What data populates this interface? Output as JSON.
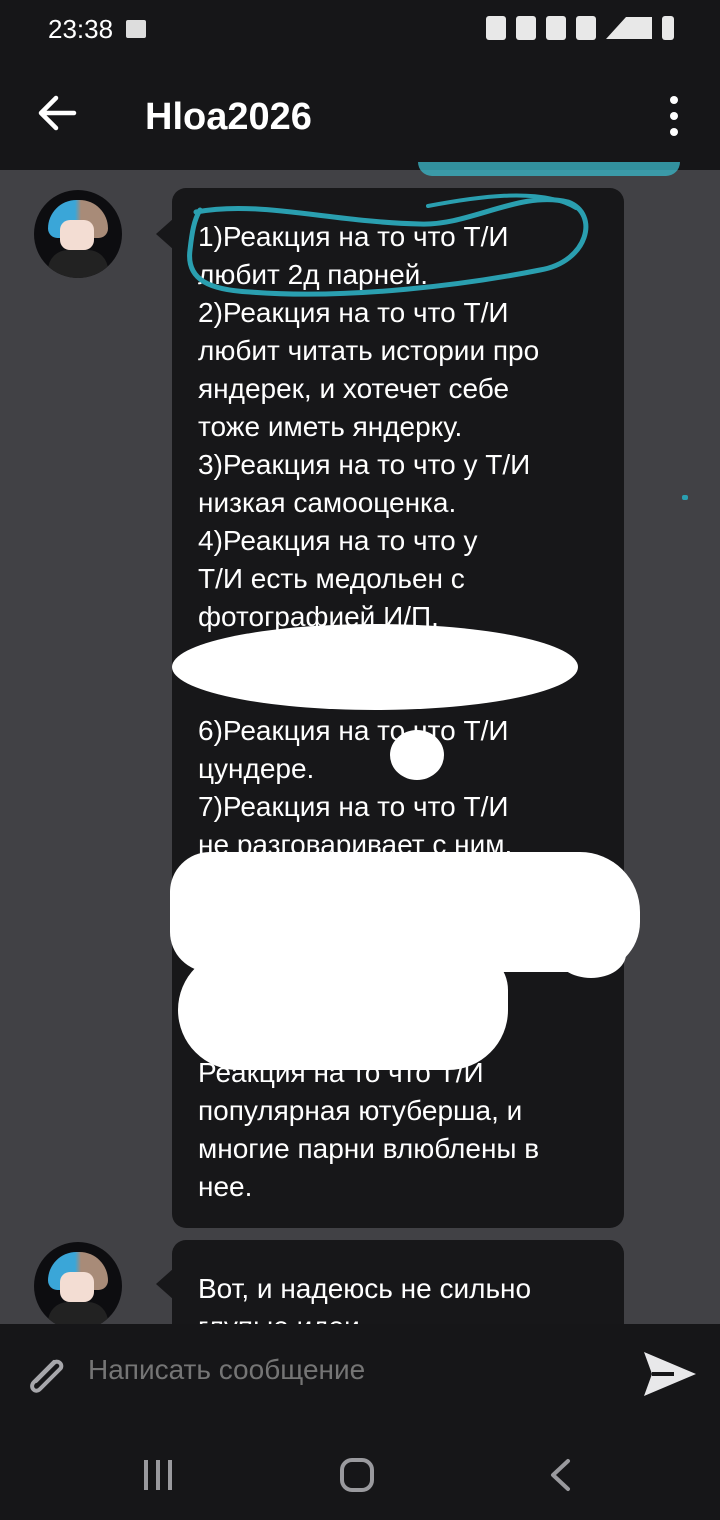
{
  "status_bar": {
    "time": "23:38"
  },
  "app_bar": {
    "title": "Hloa2026"
  },
  "messages": [
    {
      "text": "1)Реакция на то что Т/И\nлюбит 2д парней.\n2)Реакция на то что Т/И\nлюбит читать истории про\nяндерек, и хотечет себе\nтоже иметь яндерку.\n3)Реакция на то что у Т/И\nнизкая самооценка.\n4)Реакция на то что у\nТ/И есть медольен с\nфотографией И/П.\n5)\n\n6)Реакция на то что Т/И\nцундере.\n7)Реакция на то что Т/И\nне разговаривает с ним.\n\n\n\n\n\nРеакция на то что Т/И\nпопулярная ютуберша, и\nмногие парни влюблены в\nнее."
    },
    {
      "text": "Вот, и надеюсь не сильно\nглупые идеи"
    }
  ],
  "composer": {
    "placeholder": "Написать сообщение"
  }
}
